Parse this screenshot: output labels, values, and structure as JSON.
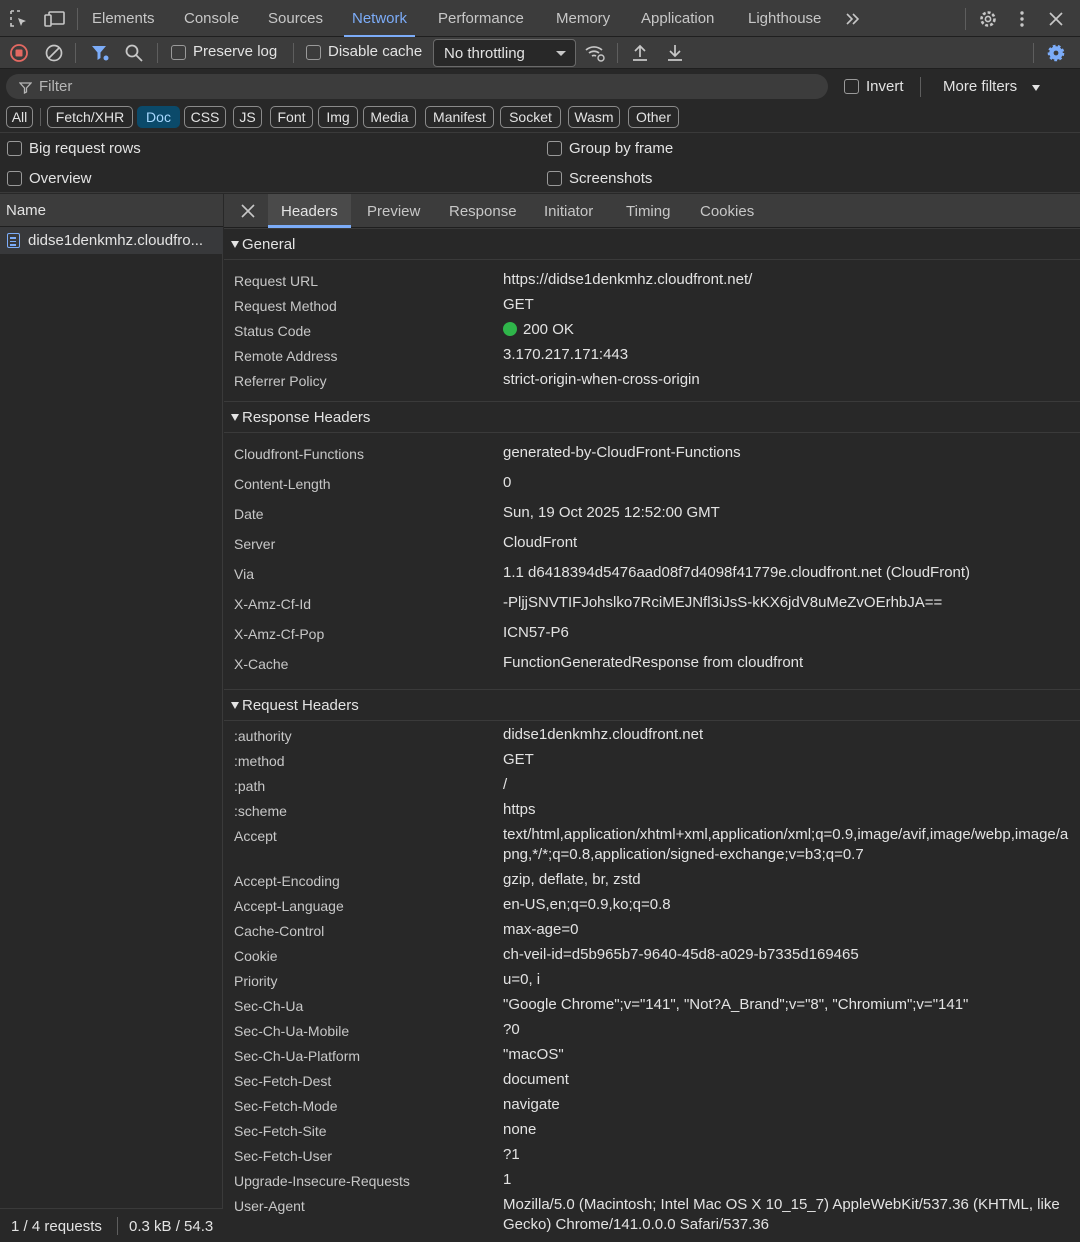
{
  "devtools": {
    "main_tabs": [
      "Elements",
      "Console",
      "Sources",
      "Network",
      "Performance",
      "Memory",
      "Application",
      "Lighthouse"
    ],
    "active_main_tab": "Network"
  },
  "toolbar": {
    "preserve_log": "Preserve log",
    "disable_cache": "Disable cache",
    "throttling": "No throttling"
  },
  "filter": {
    "placeholder": "Filter",
    "invert": "Invert",
    "more_filters": "More filters"
  },
  "type_filters": [
    "All",
    "Fetch/XHR",
    "Doc",
    "CSS",
    "JS",
    "Font",
    "Img",
    "Media",
    "Manifest",
    "Socket",
    "Wasm",
    "Other"
  ],
  "active_type_filter": "Doc",
  "options": {
    "big_request_rows": "Big request rows",
    "overview": "Overview",
    "group_by_frame": "Group by frame",
    "screenshots": "Screenshots"
  },
  "requests": {
    "column_name": "Name",
    "items": [
      "didse1denkmhz.cloudfro..."
    ],
    "status_requests": "1 / 4 requests",
    "status_size": "0.3 kB / 54.3"
  },
  "detail_tabs": [
    "Headers",
    "Preview",
    "Response",
    "Initiator",
    "Timing",
    "Cookies"
  ],
  "active_detail_tab": "Headers",
  "general": {
    "title": "General",
    "rows": [
      {
        "k": "Request URL",
        "v": "https://didse1denkmhz.cloudfront.net/"
      },
      {
        "k": "Request Method",
        "v": "GET"
      },
      {
        "k": "Status Code",
        "v": "200 OK"
      },
      {
        "k": "Remote Address",
        "v": "3.170.217.171:443"
      },
      {
        "k": "Referrer Policy",
        "v": "strict-origin-when-cross-origin"
      }
    ]
  },
  "response_headers": {
    "title": "Response Headers",
    "rows": [
      {
        "k": "Cloudfront-Functions",
        "v": "generated-by-CloudFront-Functions"
      },
      {
        "k": "Content-Length",
        "v": "0"
      },
      {
        "k": "Date",
        "v": "Sun, 19 Oct 2025 12:52:00 GMT"
      },
      {
        "k": "Server",
        "v": "CloudFront"
      },
      {
        "k": "Via",
        "v": "1.1 d6418394d5476aad08f7d4098f41779e.cloudfront.net (CloudFront)"
      },
      {
        "k": "X-Amz-Cf-Id",
        "v": "-PljjSNVTIFJohslko7RciMEJNfl3iJsS-kKX6jdV8uMeZvOErhbJA=="
      },
      {
        "k": "X-Amz-Cf-Pop",
        "v": "ICN57-P6"
      },
      {
        "k": "X-Cache",
        "v": "FunctionGeneratedResponse from cloudfront"
      }
    ]
  },
  "request_headers": {
    "title": "Request Headers",
    "rows": [
      {
        "k": ":authority",
        "v": "didse1denkmhz.cloudfront.net"
      },
      {
        "k": ":method",
        "v": "GET"
      },
      {
        "k": ":path",
        "v": "/"
      },
      {
        "k": ":scheme",
        "v": "https"
      },
      {
        "k": "Accept",
        "v": "text/html,application/xhtml+xml,application/xml;q=0.9,image/avif,image/webp,image/apng,*/*;q=0.8,application/signed-exchange;v=b3;q=0.7"
      },
      {
        "k": "Accept-Encoding",
        "v": "gzip, deflate, br, zstd"
      },
      {
        "k": "Accept-Language",
        "v": "en-US,en;q=0.9,ko;q=0.8"
      },
      {
        "k": "Cache-Control",
        "v": "max-age=0"
      },
      {
        "k": "Cookie",
        "v": "ch-veil-id=d5b965b7-9640-45d8-a029-b7335d169465"
      },
      {
        "k": "Priority",
        "v": "u=0, i"
      },
      {
        "k": "Sec-Ch-Ua",
        "v": "\"Google Chrome\";v=\"141\", \"Not?A_Brand\";v=\"8\", \"Chromium\";v=\"141\""
      },
      {
        "k": "Sec-Ch-Ua-Mobile",
        "v": "?0"
      },
      {
        "k": "Sec-Ch-Ua-Platform",
        "v": "\"macOS\""
      },
      {
        "k": "Sec-Fetch-Dest",
        "v": "document"
      },
      {
        "k": "Sec-Fetch-Mode",
        "v": "navigate"
      },
      {
        "k": "Sec-Fetch-Site",
        "v": "none"
      },
      {
        "k": "Sec-Fetch-User",
        "v": "?1"
      },
      {
        "k": "Upgrade-Insecure-Requests",
        "v": "1"
      },
      {
        "k": "User-Agent",
        "v": "Mozilla/5.0 (Macintosh; Intel Mac OS X 10_15_7) AppleWebKit/537.36 (KHTML, like Gecko) Chrome/141.0.0.0 Safari/537.36"
      }
    ]
  },
  "colors": {
    "accent": "#7cacf8",
    "status_ok": "#2fb54a",
    "record_stop": "#e46962"
  }
}
